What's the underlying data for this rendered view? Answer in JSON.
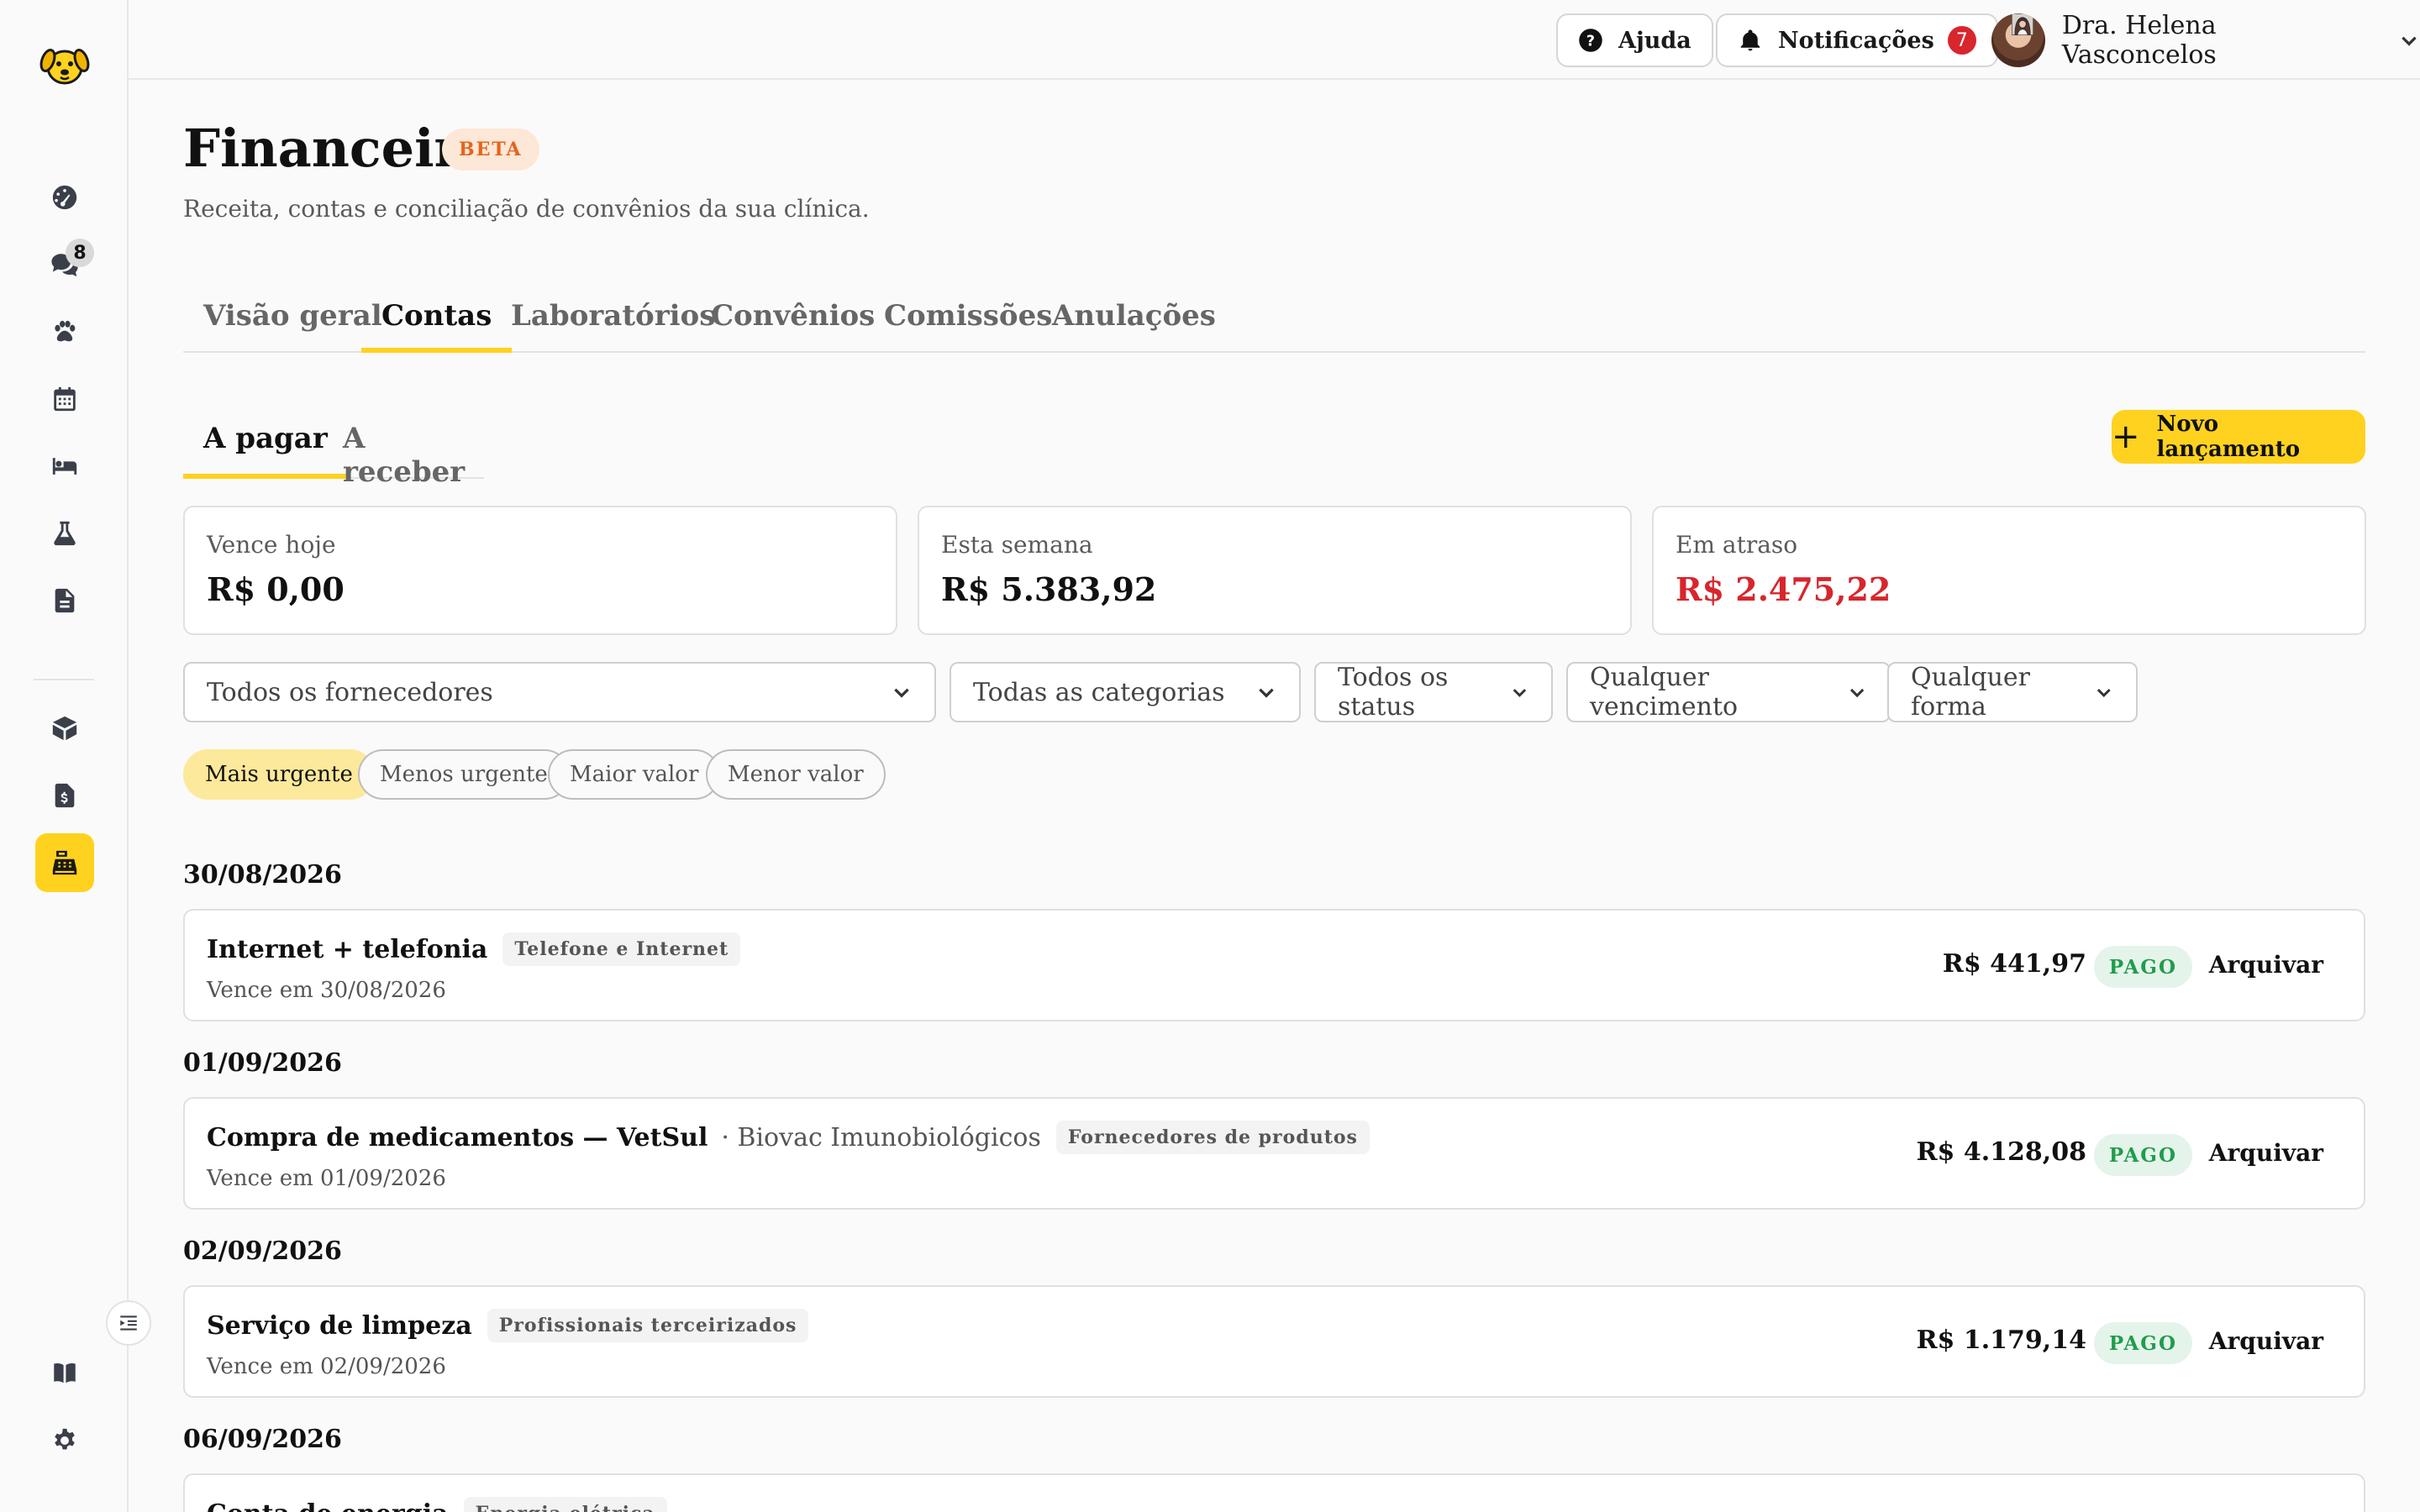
{
  "app": {
    "logo_icon": "dog-logo-icon"
  },
  "sidebar": {
    "items": [
      {
        "icon": "dashboard-icon",
        "badge": ""
      },
      {
        "icon": "chat-icon",
        "badge": "8"
      },
      {
        "icon": "paw-icon",
        "badge": ""
      },
      {
        "icon": "calendar-icon",
        "badge": ""
      },
      {
        "icon": "bed-icon",
        "badge": ""
      },
      {
        "icon": "flask-icon",
        "badge": ""
      },
      {
        "icon": "document-icon",
        "badge": ""
      },
      {
        "icon": "box-icon",
        "badge": ""
      },
      {
        "icon": "invoice-icon",
        "badge": ""
      },
      {
        "icon": "cash-register-icon",
        "badge": "",
        "active": true
      }
    ],
    "bottom": [
      {
        "icon": "book-icon"
      },
      {
        "icon": "gear-icon"
      }
    ]
  },
  "topbar": {
    "help_label": "Ajuda",
    "notifications_label": "Notificações",
    "notifications_count": "7",
    "user_name": "Dra. Helena Vasconcelos"
  },
  "header": {
    "title": "Financeiro",
    "badge": "BETA",
    "subtitle": "Receita, contas e conciliação de convênios da sua clínica."
  },
  "tabs": [
    "Visão geral",
    "Contas",
    "Laboratórios",
    "Convênios",
    "Comissões",
    "Anulações"
  ],
  "active_tab": "Contas",
  "subtabs": [
    "A pagar",
    "A receber"
  ],
  "active_subtab": "A pagar",
  "new_button_label": "Novo lançamento",
  "summary": [
    {
      "label": "Vence hoje",
      "value": "R$ 0,00"
    },
    {
      "label": "Esta semana",
      "value": "R$ 5.383,92"
    },
    {
      "label": "Em atraso",
      "value": "R$ 2.475,22",
      "color": "#d7262c"
    }
  ],
  "filters": [
    "Todos os fornecedores",
    "Todas as categorias",
    "Todos os status",
    "Qualquer vencimento",
    "Qualquer forma"
  ],
  "sort_chips": [
    "Mais urgente",
    "Menos urgente",
    "Maior valor",
    "Menor valor"
  ],
  "active_sort": "Mais urgente",
  "groups": [
    {
      "date": "30/08/2026",
      "entries": [
        {
          "name": "Internet + telefonia",
          "supplier": "",
          "tag": "Telefone e Internet",
          "due": "Vence em 30/08/2026",
          "amount": "R$ 441,97",
          "status": "PAGO",
          "action": "Arquivar"
        }
      ]
    },
    {
      "date": "01/09/2026",
      "entries": [
        {
          "name": "Compra de medicamentos — VetSul",
          "supplier": "· Biovac Imunobiológicos",
          "tag": "Fornecedores de produtos",
          "due": "Vence em 01/09/2026",
          "amount": "R$ 4.128,08",
          "status": "PAGO",
          "action": "Arquivar"
        }
      ]
    },
    {
      "date": "02/09/2026",
      "entries": [
        {
          "name": "Serviço de limpeza",
          "supplier": "",
          "tag": "Profissionais terceirizados",
          "due": "Vence em 02/09/2026",
          "amount": "R$ 1.179,14",
          "status": "PAGO",
          "action": "Arquivar"
        }
      ]
    },
    {
      "date": "06/09/2026",
      "entries": [
        {
          "name": "Conta de energia",
          "supplier": "",
          "tag": "Energia elétrica",
          "due": "",
          "amount": "",
          "status": "",
          "action": ""
        }
      ]
    }
  ],
  "colors": {
    "accent": "#ffd21f",
    "danger": "#d7262c",
    "success": "#1f9d4c"
  }
}
